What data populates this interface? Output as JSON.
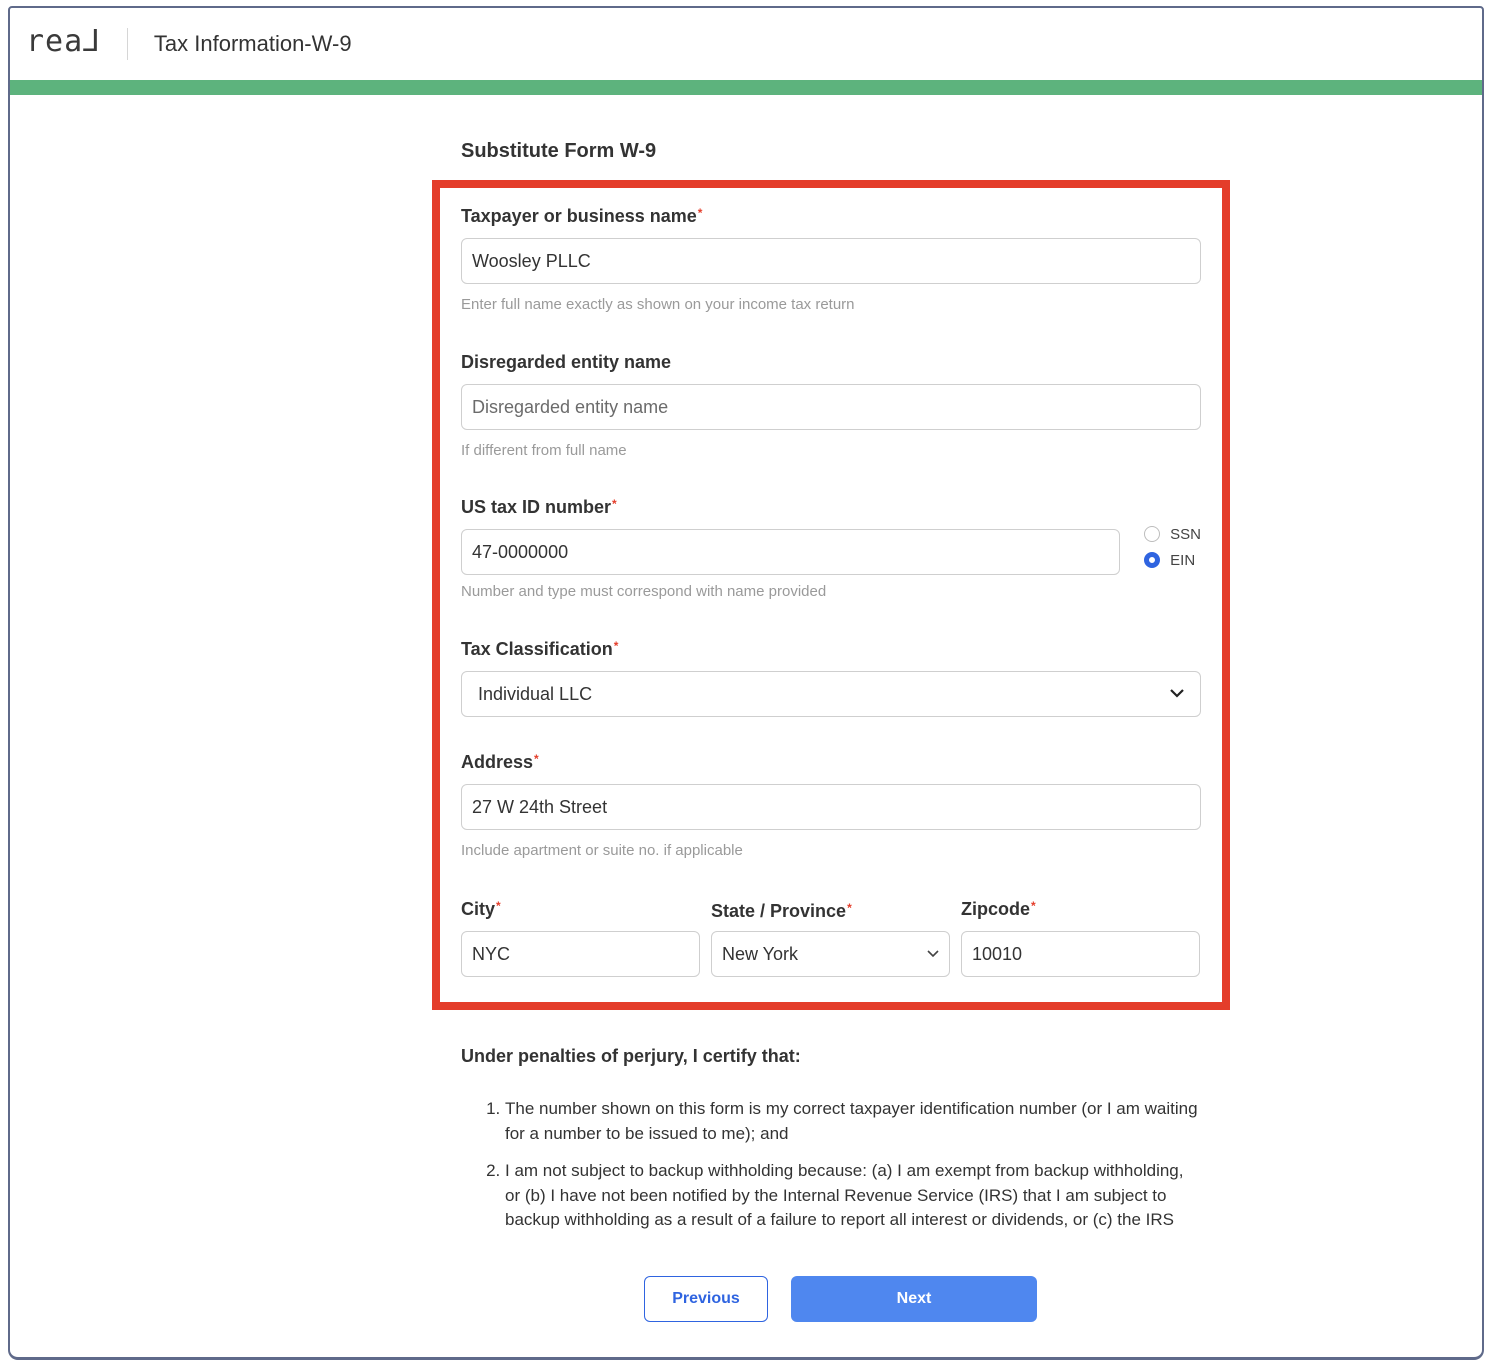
{
  "header": {
    "logo_text": "rea⅃",
    "title": "Tax Information-W-9"
  },
  "progress": {
    "percent": 100,
    "color": "#5db37d"
  },
  "form": {
    "title": "Substitute Form W-9",
    "taxpayer_name": {
      "label": "Taxpayer or business name",
      "required_mark": "*",
      "value": "Woosley PLLC",
      "hint": "Enter full name exactly as shown on your income tax return"
    },
    "disregarded_entity": {
      "label": "Disregarded entity name",
      "placeholder": "Disregarded entity name",
      "hint": "If different from full name"
    },
    "tax_id": {
      "label": "US tax ID number",
      "required_mark": "*",
      "value": "47-0000000",
      "hint": "Number and type must correspond with name provided",
      "options": [
        "SSN",
        "EIN"
      ],
      "selected": "EIN"
    },
    "tax_classification": {
      "label": "Tax Classification",
      "required_mark": "*",
      "value": "Individual LLC"
    },
    "address": {
      "label": "Address",
      "required_mark": "*",
      "value": "27 W 24th Street",
      "hint": "Include apartment or suite no. if applicable"
    },
    "city": {
      "label": "City",
      "required_mark": "*",
      "value": "NYC"
    },
    "state": {
      "label": "State / Province",
      "required_mark": "*",
      "value": "New York"
    },
    "zipcode": {
      "label": "Zipcode",
      "required_mark": "*",
      "value": "10010"
    }
  },
  "certification": {
    "title": "Under penalties of perjury, I certify that:",
    "items": [
      "The number shown on this form is my correct taxpayer identification number (or I am waiting for a number to be issued to me); and",
      "I am not subject to backup withholding because: (a) I am exempt from backup withholding, or (b) I have not been notified by the Internal Revenue Service (IRS) that I am subject to backup withholding as a result of a failure to report all interest or dividends, or (c) the IRS has notified me that I am no longer subject to backup"
    ]
  },
  "buttons": {
    "previous": "Previous",
    "next": "Next"
  },
  "colors": {
    "accent": "#2f64e0",
    "next_button": "#4f87ef",
    "highlight": "#e43d2a",
    "required": "#e43d2a"
  }
}
